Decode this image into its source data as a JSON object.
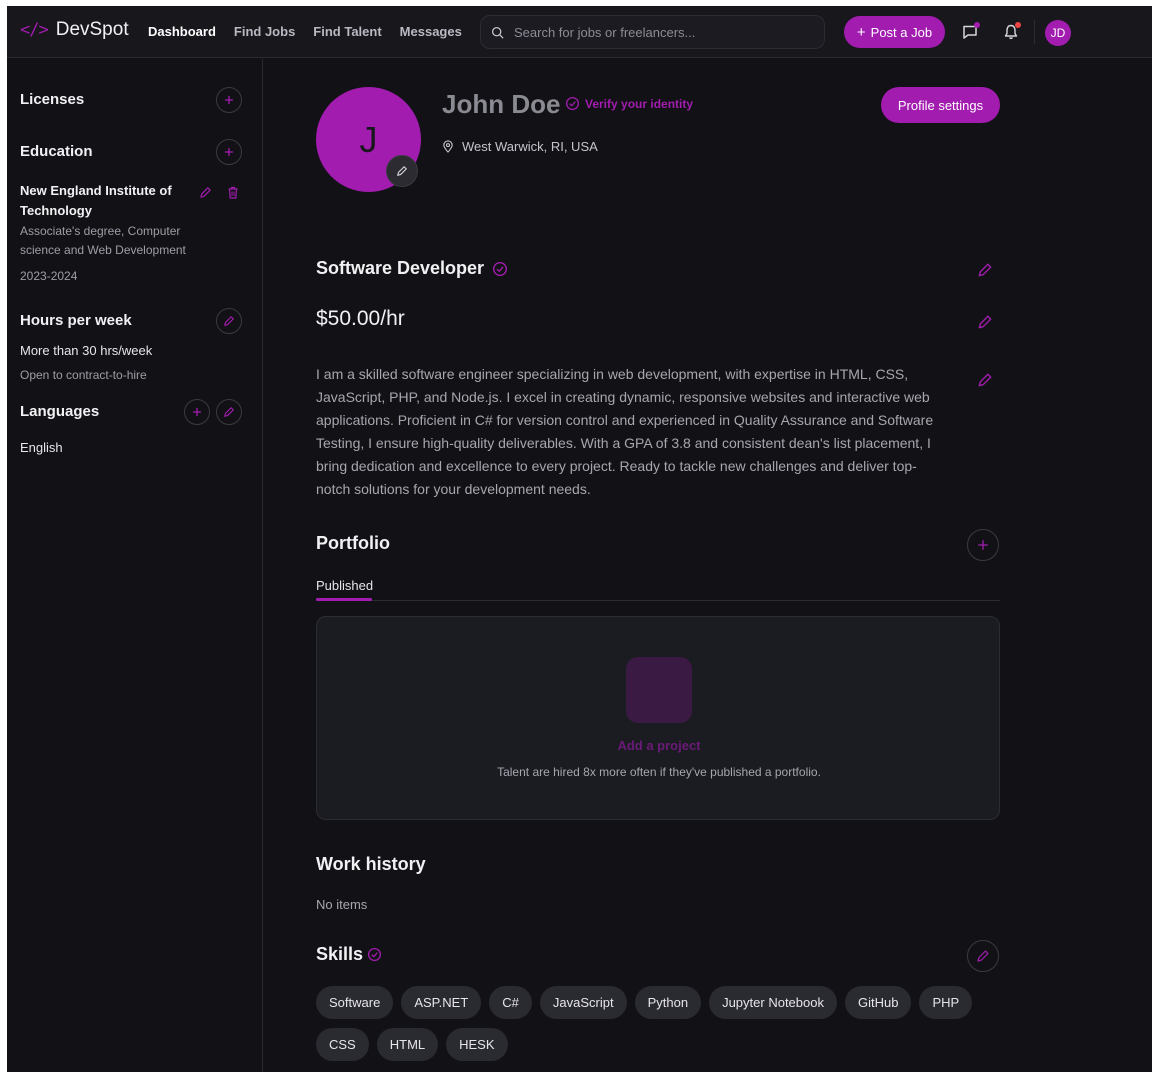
{
  "header": {
    "logo_mark": "</>",
    "logo_text": "DevSpot",
    "nav": [
      "Dashboard",
      "Find Jobs",
      "Find Talent",
      "Messages"
    ],
    "search_placeholder": "Search for jobs or freelancers...",
    "post_job_label": "Post a Job",
    "avatar_initials": "JD",
    "message_dot_color": "#a21caf",
    "notification_dot_color": "#ef4444"
  },
  "sidebar": {
    "licenses_title": "Licenses",
    "education_title": "Education",
    "education_item": {
      "school": "New England Institute of Technology",
      "degree": "Associate's degree, Computer science and Web Development",
      "years": "2023-2024"
    },
    "hours_title": "Hours per week",
    "hours_value": "More than 30 hrs/week",
    "hours_note": "Open to contract-to-hire",
    "languages_title": "Languages",
    "language": "English"
  },
  "profile": {
    "initial": "J",
    "name": "John Doe",
    "verify_label": "Verify your identity",
    "location": "West Warwick, RI, USA",
    "settings_label": "Profile settings",
    "title": "Software Developer",
    "rate": "$50.00/hr",
    "bio": "I am a skilled software engineer specializing in web development, with expertise in HTML, CSS, JavaScript, PHP, and Node.js. I excel in creating dynamic, responsive websites and interactive web applications. Proficient in C# for version control and experienced in Quality Assurance and Software Testing, I ensure high-quality deliverables. With a GPA of 3.8 and consistent dean's list placement, I bring dedication and excellence to every project. Ready to tackle new challenges and deliver top-notch solutions for your development needs."
  },
  "portfolio": {
    "title": "Portfolio",
    "tab": "Published",
    "add_label": "Add a project",
    "note": "Talent are hired 8x more often if they've published a portfolio."
  },
  "work_history": {
    "title": "Work history",
    "empty": "No items"
  },
  "skills": {
    "title": "Skills",
    "items": [
      "Software",
      "ASP.NET",
      "C#",
      "JavaScript",
      "Python",
      "Jupyter Notebook",
      "GitHub",
      "PHP",
      "CSS",
      "HTML",
      "HESK"
    ]
  },
  "colors": {
    "accent": "#a21caf",
    "background": "#121216"
  }
}
